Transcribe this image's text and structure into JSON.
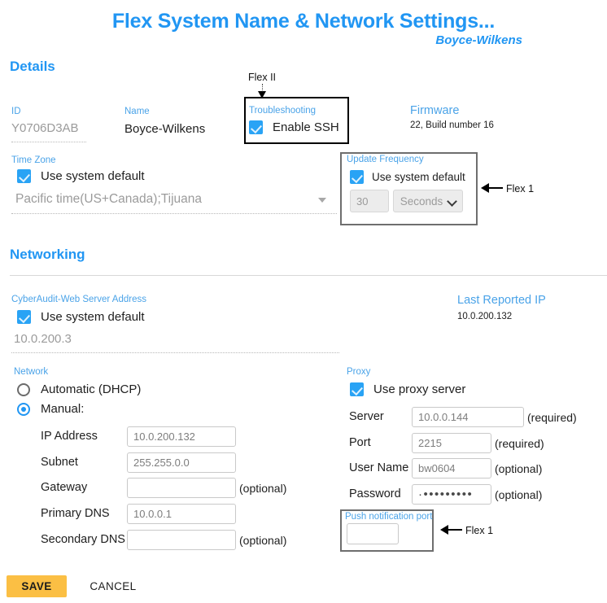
{
  "header": {
    "title": "Flex System Name & Network Settings...",
    "subtitle": "Boyce-Wilkens"
  },
  "sections": {
    "details_heading": "Details",
    "networking_heading": "Networking"
  },
  "details": {
    "id_label": "ID",
    "id_value": "Y0706D3AB",
    "name_label": "Name",
    "name_value": "Boyce-Wilkens",
    "timezone_label": "Time Zone",
    "timezone_use_default_label": "Use system default",
    "timezone_value": "Pacific time(US+Canada);Tijuana",
    "troubleshooting_label": "Troubleshooting",
    "enable_ssh_label": "Enable SSH",
    "firmware_label": "Firmware",
    "firmware_value": "22, Build number 16",
    "update_frequency_label": "Update Frequency",
    "update_use_default_label": "Use system default",
    "update_interval_value": "30",
    "update_unit_value": "Seconds"
  },
  "networking": {
    "cyberaudit_label": "CyberAudit-Web Server Address",
    "cyberaudit_use_default_label": "Use system default",
    "cyberaudit_value": "10.0.200.3",
    "last_reported_ip_label": "Last Reported IP",
    "last_reported_ip_value": "10.0.200.132"
  },
  "network": {
    "group_label": "Network",
    "dhcp_label": "Automatic (DHCP)",
    "manual_label": "Manual:",
    "fields": [
      {
        "label": "IP Address",
        "value": "10.0.200.132",
        "hint": ""
      },
      {
        "label": "Subnet",
        "value": "255.255.0.0",
        "hint": ""
      },
      {
        "label": "Gateway",
        "value": "",
        "hint": "(optional)"
      },
      {
        "label": "Primary DNS",
        "value": "10.0.0.1",
        "hint": ""
      },
      {
        "label": "Secondary DNS",
        "value": "",
        "hint": "(optional)"
      }
    ]
  },
  "proxy": {
    "group_label": "Proxy",
    "use_proxy_label": "Use proxy server",
    "fields": [
      {
        "label": "Server",
        "value": "10.0.0.144",
        "hint": "(required)"
      },
      {
        "label": "Port",
        "value": "2215",
        "hint": "(required)"
      },
      {
        "label": "User Name",
        "value": "bw0604",
        "hint": "(optional)"
      },
      {
        "label": "Password",
        "value": "·•••••••••",
        "hint": "(optional)"
      }
    ],
    "push_port_label": "Push notification port",
    "push_port_value": ""
  },
  "annotations": {
    "flex_two": "Flex II",
    "flex_one_update": "Flex 1",
    "flex_one_push": "Flex 1"
  },
  "footer": {
    "save_label": "SAVE",
    "cancel_label": "CANCEL"
  },
  "colors": {
    "accent_blue": "#2196f3",
    "label_blue": "#4aa3e8",
    "save_amber": "#fbbf44"
  }
}
